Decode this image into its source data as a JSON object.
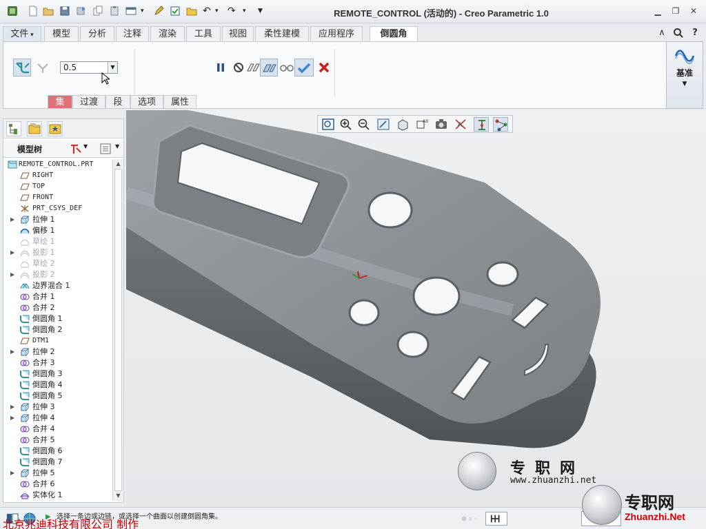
{
  "window": {
    "title": "REMOTE_CONTROL (活动的) - Creo Parametric 1.0",
    "controls": [
      "minimize-icon",
      "restore-icon",
      "close-icon"
    ]
  },
  "ribbon": {
    "file_tab": "文件",
    "tabs": [
      "模型",
      "分析",
      "注释",
      "渲染",
      "工具",
      "视图",
      "柔性建模",
      "应用程序"
    ],
    "active_tab": "倒圆角",
    "radius_value": "0.5",
    "subtabs": [
      "集",
      "过渡",
      "段",
      "选项",
      "属性"
    ],
    "selected_subtab": "集",
    "datum_group": "基准"
  },
  "model_tree": {
    "title": "模型树",
    "nodes": [
      {
        "label": "REMOTE_CONTROL.PRT",
        "icon": "part-icon",
        "expand": "",
        "root": true
      },
      {
        "label": "RIGHT",
        "icon": "datum-plane-icon",
        "expand": "",
        "mono": true
      },
      {
        "label": "TOP",
        "icon": "datum-plane-icon",
        "expand": "",
        "mono": true
      },
      {
        "label": "FRONT",
        "icon": "datum-plane-icon",
        "expand": "",
        "mono": true
      },
      {
        "label": "PRT_CSYS_DEF",
        "icon": "csys-icon",
        "expand": "",
        "mono": true
      },
      {
        "label": "拉伸 1",
        "icon": "extrude-icon",
        "expand": "▶"
      },
      {
        "label": "偏移 1",
        "icon": "offset-icon",
        "expand": ""
      },
      {
        "label": "草绘 1",
        "icon": "sketch-icon",
        "expand": "",
        "dim": true
      },
      {
        "label": "投影 1",
        "icon": "project-icon",
        "expand": "▶",
        "dim": true
      },
      {
        "label": "草绘 2",
        "icon": "sketch-icon",
        "expand": "",
        "dim": true
      },
      {
        "label": "投影 2",
        "icon": "project-icon",
        "expand": "▶",
        "dim": true
      },
      {
        "label": "边界混合 1",
        "icon": "boundary-blend-icon",
        "expand": ""
      },
      {
        "label": "合并 1",
        "icon": "merge-icon",
        "expand": ""
      },
      {
        "label": "合并 2",
        "icon": "merge-icon",
        "expand": ""
      },
      {
        "label": "倒圆角 1",
        "icon": "round-icon",
        "expand": ""
      },
      {
        "label": "倒圆角 2",
        "icon": "round-icon",
        "expand": ""
      },
      {
        "label": "DTM1",
        "icon": "datum-plane-icon",
        "expand": "",
        "mono": true
      },
      {
        "label": "拉伸 2",
        "icon": "extrude-icon",
        "expand": "▶"
      },
      {
        "label": "合并 3",
        "icon": "merge-icon",
        "expand": ""
      },
      {
        "label": "倒圆角 3",
        "icon": "round-icon",
        "expand": ""
      },
      {
        "label": "倒圆角 4",
        "icon": "round-icon",
        "expand": ""
      },
      {
        "label": "倒圆角 5",
        "icon": "round-icon",
        "expand": ""
      },
      {
        "label": "拉伸 3",
        "icon": "extrude-icon",
        "expand": "▶"
      },
      {
        "label": "拉伸 4",
        "icon": "extrude-icon",
        "expand": "▶"
      },
      {
        "label": "合并 4",
        "icon": "merge-icon",
        "expand": ""
      },
      {
        "label": "合并 5",
        "icon": "merge-icon",
        "expand": ""
      },
      {
        "label": "倒圆角 6",
        "icon": "round-icon",
        "expand": ""
      },
      {
        "label": "倒圆角 7",
        "icon": "round-icon",
        "expand": ""
      },
      {
        "label": "拉伸 5",
        "icon": "extrude-icon",
        "expand": "▶"
      },
      {
        "label": "合并 6",
        "icon": "merge-icon",
        "expand": ""
      },
      {
        "label": "实体化 1",
        "icon": "solidify-icon",
        "expand": ""
      }
    ]
  },
  "status": {
    "message": "选择一条边或边链，或选择一个曲面以创建倒圆角集。",
    "overlay": "北京兆迪科技有限公司    制作"
  },
  "watermark": {
    "text1": "专职网",
    "url1": "www.zhuanzhi.net",
    "text2": "专职网",
    "url2": "Zhuanzhi.Net"
  },
  "colors": {
    "accent_tab": "#e07178",
    "model_gray": "#8d9397",
    "confirm_green": "#2a7fcf",
    "cancel_red": "#d21919"
  }
}
